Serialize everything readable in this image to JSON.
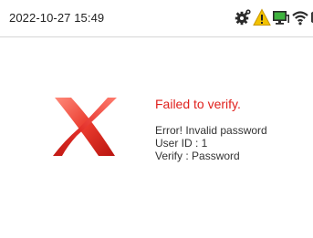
{
  "status_bar": {
    "datetime": "2022-10-27 15:49",
    "icons": [
      "settings-gear-icon",
      "warning-icon",
      "network-computer-icon",
      "wifi-icon",
      "camera-icon"
    ]
  },
  "result": {
    "icon": "fail-x-icon",
    "title": "Failed to verify.",
    "error_line": "Error! Invalid password",
    "user_id_line": "User ID : 1",
    "verify_line": "Verify : Password"
  },
  "colors": {
    "error_red": "#e0211d",
    "warning_yellow": "#f2c200"
  }
}
